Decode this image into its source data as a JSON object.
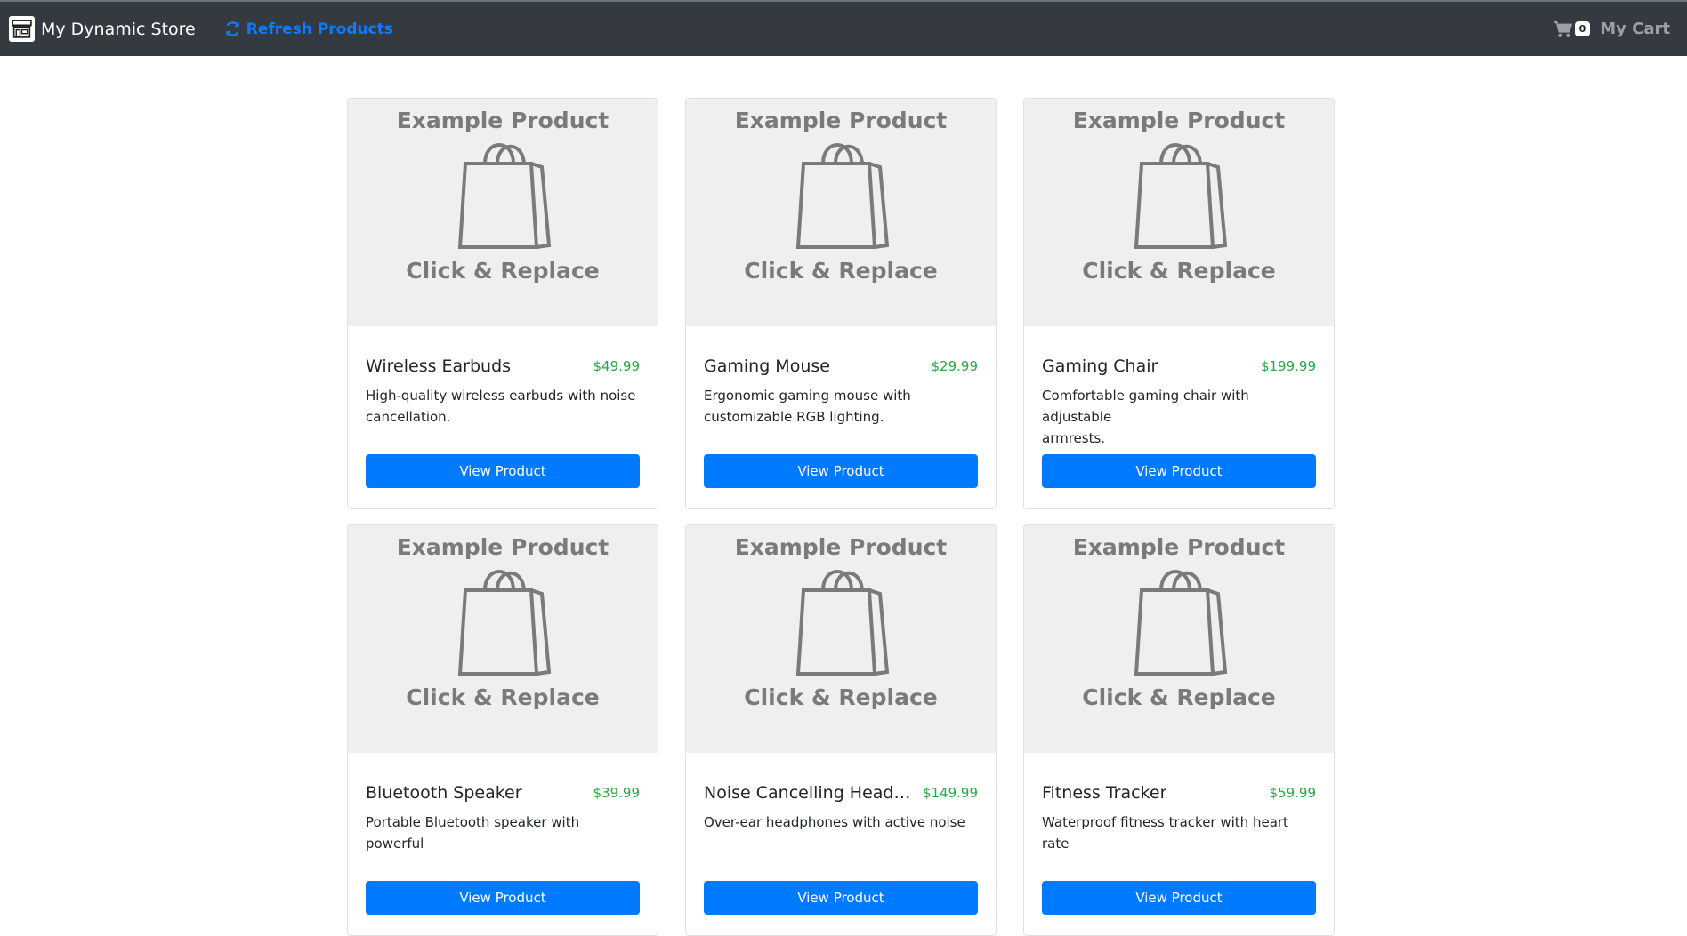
{
  "navbar": {
    "brand_icon": "store-icon",
    "brand_text": "My Dynamic Store",
    "refresh_icon": "sync-icon",
    "refresh_label": "Refresh Products",
    "cart_icon": "shopping-cart-icon",
    "cart_count": "0",
    "cart_label": "My Cart"
  },
  "placeholder": {
    "title": "Example Product",
    "icon": "shopping-bag-icon",
    "caption": "Click & Replace"
  },
  "products": [
    {
      "name": "Wireless Earbuds",
      "price": "$49.99",
      "desc_line1": "High-quality wireless earbuds with noise",
      "desc_line2": "cancellation.",
      "button": "View Product"
    },
    {
      "name": "Gaming Mouse",
      "price": "$29.99",
      "desc_line1": "Ergonomic gaming mouse with",
      "desc_line2": "customizable RGB lighting.",
      "button": "View Product"
    },
    {
      "name": "Gaming Chair",
      "price": "$199.99",
      "desc_line1": "Comfortable gaming chair with adjustable",
      "desc_line2": "armrests.",
      "button": "View Product"
    },
    {
      "name": "Bluetooth Speaker",
      "price": "$39.99",
      "desc_line1": "Portable Bluetooth speaker with powerful",
      "desc_line2": "",
      "button": "View Product"
    },
    {
      "name": "Noise Cancelling Headp...",
      "price": "$149.99",
      "desc_line1": "Over-ear headphones with active noise",
      "desc_line2": "",
      "button": "View Product"
    },
    {
      "name": "Fitness Tracker",
      "price": "$59.99",
      "desc_line1": "Waterproof fitness tracker with heart rate",
      "desc_line2": "",
      "button": "View Product"
    }
  ],
  "colors": {
    "navbar_bg": "#343a40",
    "accent": "#007bff",
    "price": "#28a745"
  }
}
